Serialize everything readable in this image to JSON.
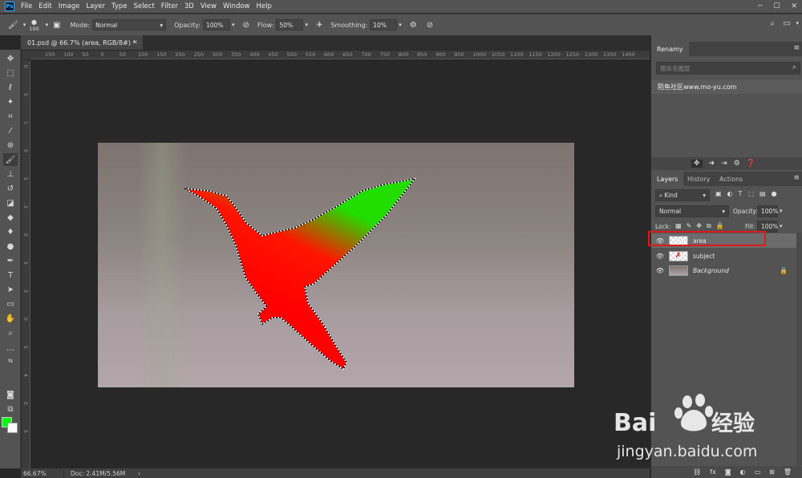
{
  "menubar": {
    "app_icon": "Ps",
    "items": [
      "File",
      "Edit",
      "Image",
      "Layer",
      "Type",
      "Select",
      "Filter",
      "3D",
      "View",
      "Window",
      "Help"
    ]
  },
  "options": {
    "brush_size": "100",
    "mode_label": "Mode:",
    "mode_value": "Normal",
    "opacity_label": "Opacity:",
    "opacity_value": "100%",
    "flow_label": "Flow:",
    "flow_value": "50%",
    "smoothing_label": "Smoothing:",
    "smoothing_value": "10%"
  },
  "document": {
    "tab_title": "01.psd @ 66.7% (area, RGB/8#) *",
    "close": "×"
  },
  "ruler": {
    "h_ticks": [
      "150",
      "100",
      "50",
      "0",
      "50",
      "100",
      "150",
      "200",
      "250",
      "300",
      "350",
      "400",
      "450",
      "500",
      "550",
      "600",
      "650",
      "700",
      "750",
      "800",
      "850",
      "900",
      "950",
      "1000",
      "1050",
      "1100",
      "1150",
      "1200",
      "1250",
      "1300",
      "1350",
      "1400"
    ],
    "v_ticks": [
      "0",
      "5",
      "1",
      "0",
      "5",
      "2",
      "0",
      "5",
      "3",
      "0",
      "5",
      "4",
      "0",
      "5"
    ]
  },
  "status": {
    "zoom": "66.67%",
    "doc": "Doc: 2.41M/5.56M",
    "arrow": "›"
  },
  "renamy": {
    "title": "Renamy",
    "search_placeholder": "搜命名图层",
    "item": "陌鱼社区www.mo-yu.com"
  },
  "layers_panel": {
    "tabs": [
      "Layers",
      "History",
      "Actions"
    ],
    "filter_kind": "Kind",
    "blend_mode": "Normal",
    "opacity_label": "Opacity:",
    "opacity_value": "100%",
    "lock_label": "Lock:",
    "fill_label": "Fill:",
    "fill_value": "100%",
    "layers": [
      {
        "name": "area",
        "selected": true
      },
      {
        "name": "subject",
        "selected": false
      },
      {
        "name": "Background",
        "selected": false
      }
    ]
  },
  "watermark": {
    "brand_left": "Bai",
    "brand_right": "经验",
    "url": "jingyan.baidu.com"
  },
  "colors": {
    "foreground": "#00ff00",
    "background": "#ffffff",
    "selection_fill_start": "#ff0000",
    "selection_fill_end": "#22dd00",
    "highlight": "#e01818"
  }
}
